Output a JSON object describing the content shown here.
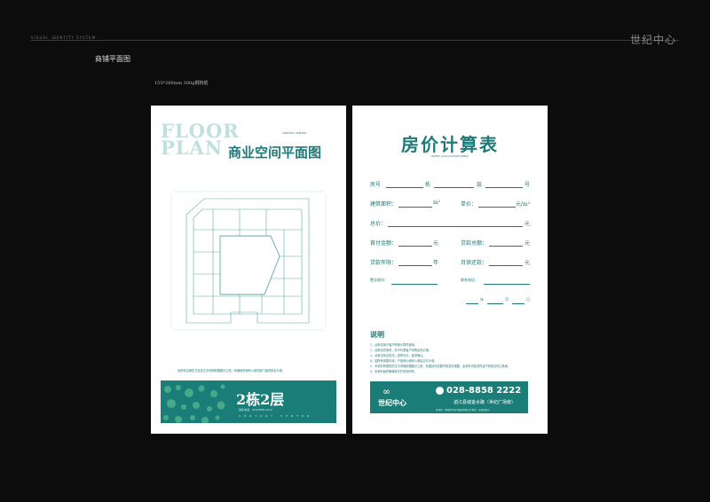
{
  "page": {
    "vis_system_label": "VISUAL IDENTITY SYSTEM",
    "brand_top": "世纪中心",
    "section_title": "商铺平面图",
    "paper_spec": "155*260mm  300g铜粉纸"
  },
  "floor_card": {
    "floor_word_1": "FLOOR",
    "floor_word_2": "PLAN",
    "century_label": "CENTURY CENTER",
    "title": "商业空间平面图",
    "note": "该资料由销售方及支文字说明依据展示之用，商铺最终面积以政府部门最终核定为准。",
    "building_label": "2栋2层",
    "banner_sub": "销售电话：028 8858 2222",
    "banner_brand": "CENTURY CENTER"
  },
  "calc_card": {
    "title": "房价计算表",
    "subtitle": "RATES CALCULATION TABLE",
    "row_room": {
      "a": "房号",
      "b": "栋",
      "c": "层",
      "d": "号"
    },
    "row_area": {
      "a": "建筑面积：",
      "b": "m²",
      "c": "单价：",
      "d": "元/m²"
    },
    "row_total": {
      "a": "总价：",
      "d": "元"
    },
    "row_pay": {
      "a": "首付金额：",
      "b": "元",
      "c": "贷款总额：",
      "d": "元"
    },
    "row_loan": {
      "a": "贷款年限：",
      "b": "年",
      "c": "月供还款：",
      "d": "元"
    },
    "row_agent": {
      "a": "置业顾问：",
      "c": "联系电话："
    },
    "row_date": {
      "a": "年",
      "b": "月",
      "c": "日"
    },
    "explain_title": "说明",
    "notes": [
      "1、此单仅用于客户购房计算时使用。",
      "2、此单仅供参考，并不代表客户将购买的价格。",
      "3、此单无效请告知，如有代办，盖章确认。",
      "4、因所有单据手续，产值核价面积以测绘文件为准。",
      "5、本资料所提供的文字说明依据展示之用，售楼处可依据市场变化调整，此资料内各项内容不构成合同之条款。",
      "6、本资料最终解释权归开发商所有。"
    ],
    "logo": "世纪中心",
    "phone": "028-8858 2222",
    "address": "湔江县城金水路（世纪广场旁）",
    "address_small": "开发商：中国新华房产集团有限公司   地址：某某路某号"
  }
}
